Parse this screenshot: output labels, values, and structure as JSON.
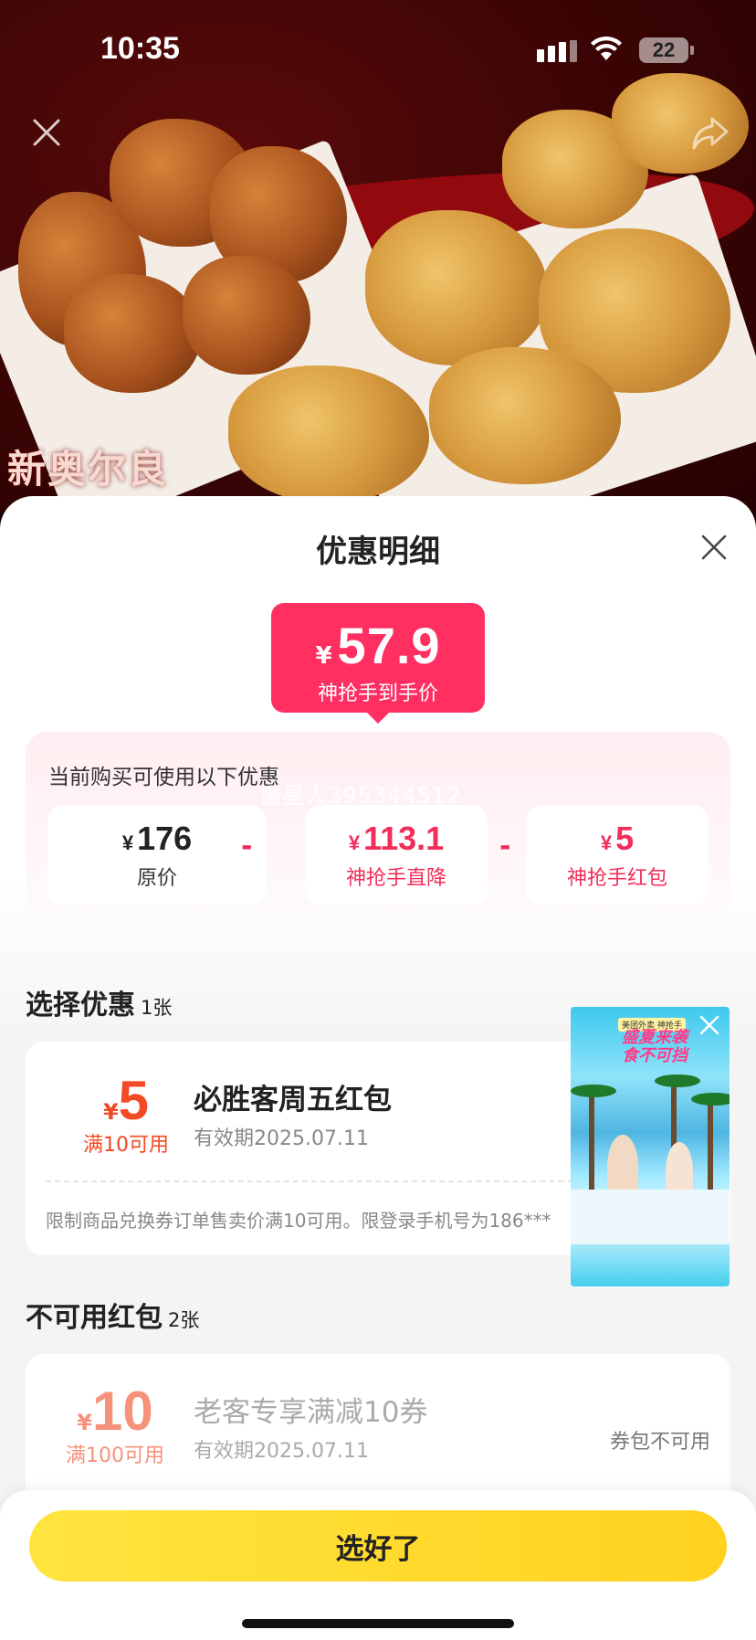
{
  "status_bar": {
    "time": "10:35",
    "battery": "22"
  },
  "hero": {
    "brand_text": "新奥尔良"
  },
  "sheet": {
    "title": "优惠明细",
    "price": {
      "currency": "¥",
      "value": "57.9",
      "label": "神抢手到手价"
    },
    "breakdown": {
      "title": "当前购买可使用以下优惠",
      "watermark": "慢星人395344512",
      "items": [
        {
          "currency": "¥",
          "value": "176",
          "label": "原价"
        },
        {
          "currency": "¥",
          "value": "113.1",
          "label": "神抢手直降"
        },
        {
          "currency": "¥",
          "value": "5",
          "label": "神抢手红包"
        }
      ],
      "operator": "-"
    },
    "select_section": {
      "title": "选择优惠",
      "count": "1张"
    },
    "active_coupon": {
      "currency": "¥",
      "amount": "5",
      "condition": "满10可用",
      "name": "必胜客周五红包",
      "expiry": "有效期2025.07.11",
      "description": "限制商品兑换券订单售卖价满10可用。限登录手机号为186***"
    },
    "unavailable_section": {
      "title": "不可用红包",
      "count": "2张"
    },
    "disabled_coupon": {
      "currency": "¥",
      "amount": "10",
      "condition": "满100可用",
      "name": "老客专享满减10券",
      "expiry": "有效期2025.07.11",
      "tag": "券包不可用"
    },
    "floating_video": {
      "tag": "美团外卖 神抢手",
      "headline_1": "盛夏来袭",
      "headline_2": "食不可挡"
    },
    "confirm_button": "选好了"
  },
  "colors": {
    "accent_pink": "#ff2f62",
    "coupon_orange": "#f24a25",
    "button_yellow": "#ffdb2b"
  }
}
